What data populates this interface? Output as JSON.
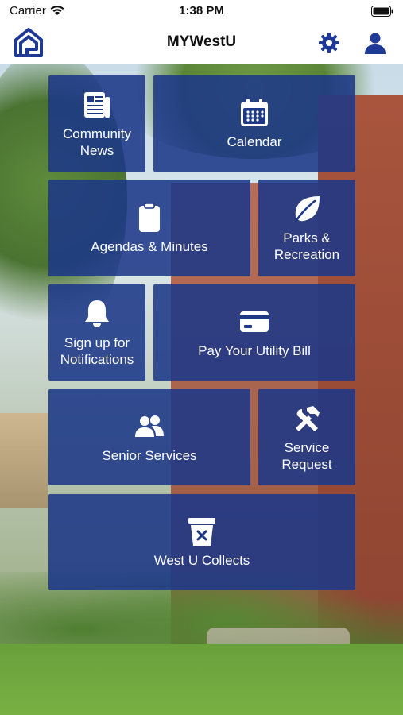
{
  "status": {
    "carrier": "Carrier",
    "time": "1:38 PM"
  },
  "nav": {
    "title": "MYWestU"
  },
  "colors": {
    "brand": "#1e3a96",
    "tile_bg": "#1c3887"
  },
  "tiles": [
    {
      "label": "Community\nNews",
      "icon": "newspaper-icon"
    },
    {
      "label": "Calendar",
      "icon": "calendar-icon"
    },
    {
      "label": "Agendas & Minutes",
      "icon": "clipboard-icon"
    },
    {
      "label": "Parks &\nRecreation",
      "icon": "leaf-icon"
    },
    {
      "label": "Sign up for\nNotifications",
      "icon": "bell-icon"
    },
    {
      "label": "Pay Your Utility Bill",
      "icon": "credit-card-icon"
    },
    {
      "label": "Senior Services",
      "icon": "users-icon"
    },
    {
      "label": "Service\nRequest",
      "icon": "tools-icon"
    },
    {
      "label": "West U Collects",
      "icon": "trash-bin-icon"
    }
  ]
}
